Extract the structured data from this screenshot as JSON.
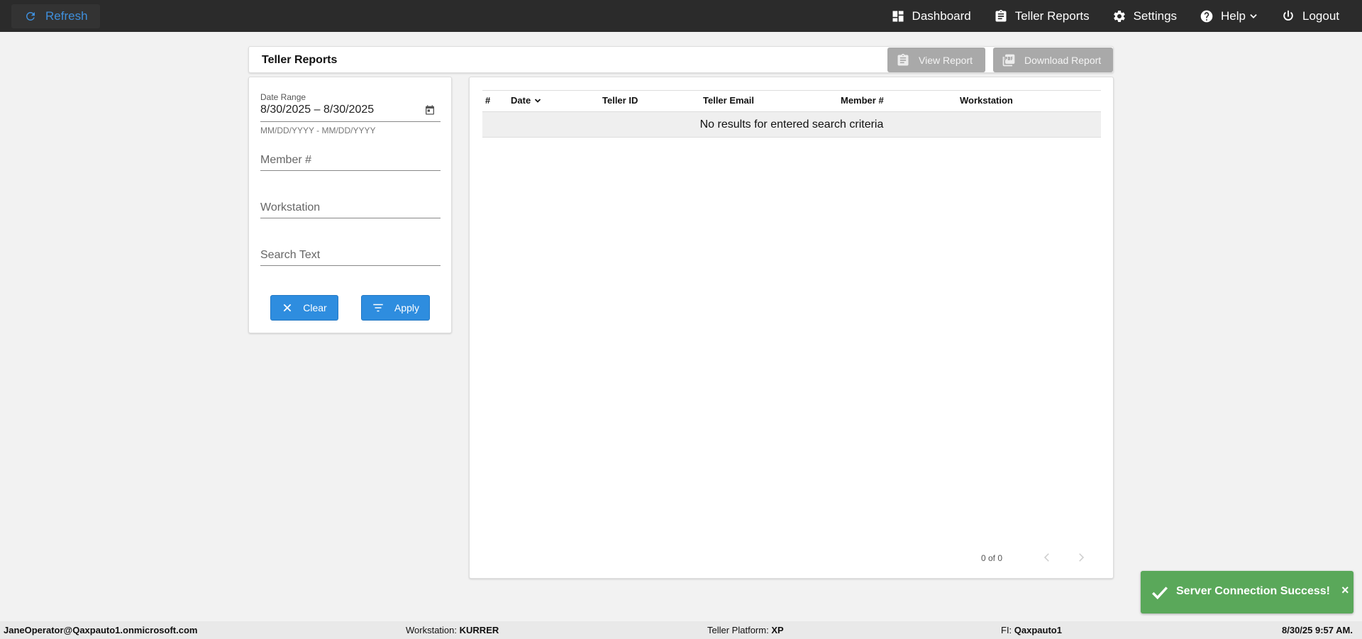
{
  "topbar": {
    "refresh_label": "Refresh",
    "nav": {
      "dashboard": "Dashboard",
      "teller_reports": "Teller Reports",
      "settings": "Settings",
      "help": "Help",
      "logout": "Logout"
    }
  },
  "header": {
    "title": "Teller Reports",
    "view_report": "View Report",
    "download_report": "Download Report"
  },
  "filters": {
    "date_range_label": "Date Range",
    "date_range_value": "8/30/2025 – 8/30/2025",
    "date_range_hint": "MM/DD/YYYY - MM/DD/YYYY",
    "member_placeholder": "Member #",
    "workstation_placeholder": "Workstation",
    "search_placeholder": "Search Text",
    "clear_label": "Clear",
    "apply_label": "Apply"
  },
  "table": {
    "columns": [
      "#",
      "Date",
      "Teller ID",
      "Teller Email",
      "Member #",
      "Workstation"
    ],
    "empty_message": "No results for entered search criteria",
    "pager": "0 of 0"
  },
  "toast": {
    "message": "Server Connection Success!",
    "close": "×"
  },
  "statusbar": {
    "user": "JaneOperator@Qaxpauto1.onmicrosoft.com",
    "workstation_label": "Workstation:",
    "workstation_value": "KURRER",
    "platform_label": "Teller Platform:",
    "platform_value": "XP",
    "fi_label": "FI:",
    "fi_value": "Qaxpauto1",
    "datetime": "8/30/25 9:57 AM."
  },
  "colors": {
    "topbar_bg": "#2b2b2b",
    "accent": "#2e8ddf",
    "refresh_text": "#3f8fdc",
    "toast_bg": "#5aa85a",
    "disabled_button": "#a9a9a9"
  }
}
